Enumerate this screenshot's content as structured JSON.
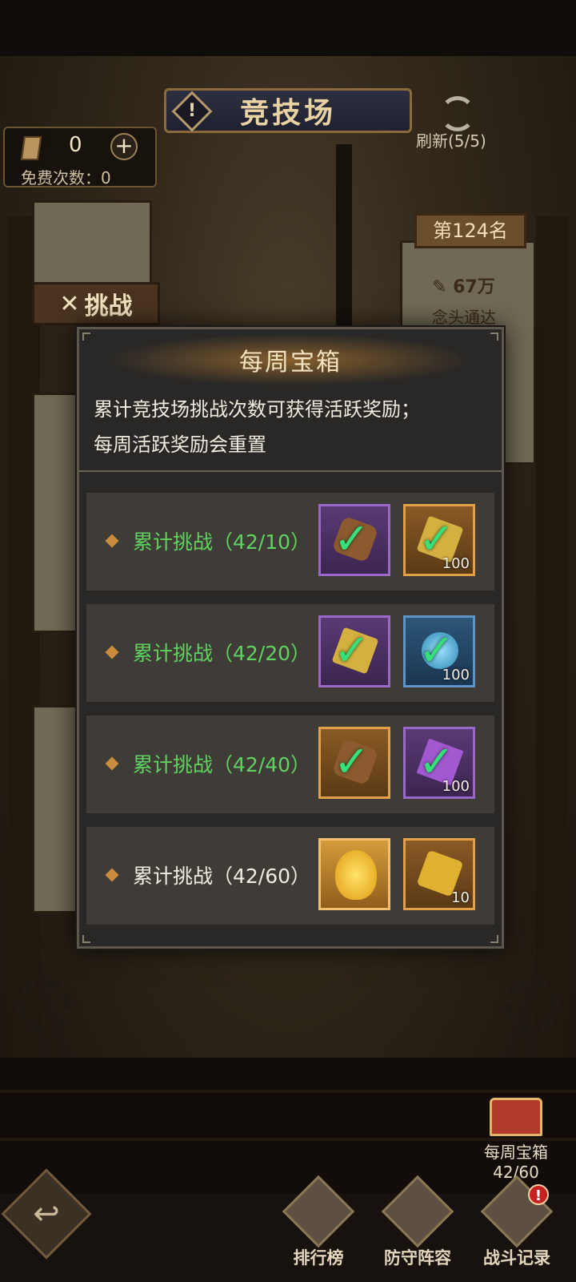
{
  "header": {
    "title": "竞技场",
    "warn_symbol": "!",
    "tickets": "0",
    "plus": "+",
    "free_times_label": "免费次数：0",
    "refresh_label": "刷新(5/5)"
  },
  "background": {
    "challenge_label": "挑战",
    "rank_label": "第124名",
    "power_label": "67万",
    "opponent_name": "念头通达"
  },
  "modal": {
    "title": "每周宝箱",
    "description_line1": "累计竞技场挑战次数可获得活跃奖励；",
    "description_line2": "每周活跃奖励会重置",
    "tasks": [
      {
        "label": "累计挑战（42/10）",
        "status": "claimed",
        "rewards": [
          {
            "icon": "ore-icon",
            "qty": ""
          },
          {
            "icon": "gold-ingot-icon",
            "qty": "100"
          }
        ]
      },
      {
        "label": "累计挑战（42/20）",
        "status": "claimed",
        "rewards": [
          {
            "icon": "gold-ore-icon",
            "qty": ""
          },
          {
            "icon": "blue-orb-icon",
            "qty": "100"
          }
        ]
      },
      {
        "label": "累计挑战（42/40）",
        "status": "claimed",
        "rewards": [
          {
            "icon": "amber-stone-icon",
            "qty": ""
          },
          {
            "icon": "purple-crystal-icon",
            "qty": "100"
          }
        ]
      },
      {
        "label": "累计挑战（42/60）",
        "status": "pending",
        "rewards": [
          {
            "icon": "golden-egg-icon",
            "qty": ""
          },
          {
            "icon": "puzzle-piece-icon",
            "qty": "10"
          }
        ]
      }
    ]
  },
  "weekly_chest": {
    "label": "每周宝箱",
    "progress": "42/60"
  },
  "bottom_nav": {
    "back_symbol": "↩",
    "leaderboard": "排行榜",
    "defense_lineup": "防守阵容",
    "battle_log": "战斗记录",
    "battle_log_badge": "!"
  },
  "colors": {
    "claimed_text": "#5fd35f",
    "pending_text": "#f1ece2",
    "check": "#33e07a"
  }
}
